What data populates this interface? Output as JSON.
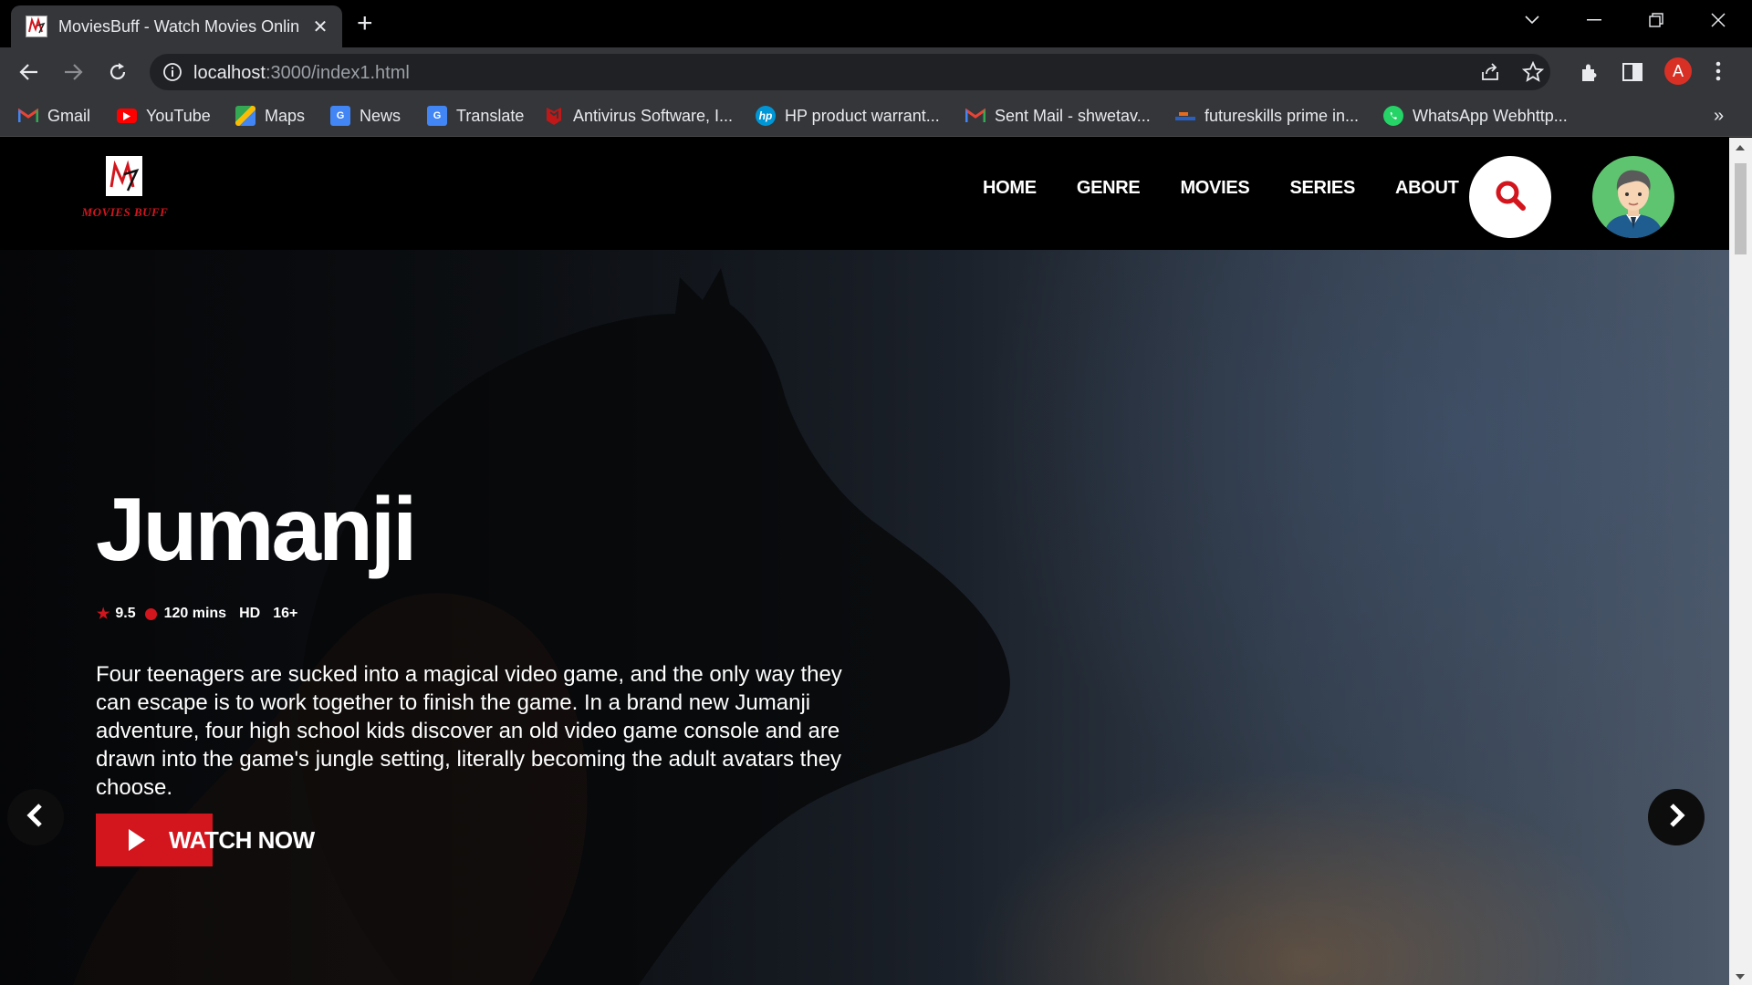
{
  "browser": {
    "tab_title": "MoviesBuff - Watch Movies Onlin",
    "url_host": "localhost",
    "url_rest": ":3000/index1.html",
    "profile_initial": "A"
  },
  "bookmarks": [
    {
      "label": "Gmail",
      "icon": "gmail-icon"
    },
    {
      "label": "YouTube",
      "icon": "youtube-icon"
    },
    {
      "label": "Maps",
      "icon": "maps-icon"
    },
    {
      "label": "News",
      "icon": "news-icon"
    },
    {
      "label": "Translate",
      "icon": "translate-icon"
    },
    {
      "label": "Antivirus Software, I...",
      "icon": "mcafee-icon"
    },
    {
      "label": "HP product warrant...",
      "icon": "hp-icon"
    },
    {
      "label": "Sent Mail - shwetav...",
      "icon": "gmail-icon"
    },
    {
      "label": "futureskills prime in...",
      "icon": "futureskills-icon"
    },
    {
      "label": "WhatsApp Webhttp...",
      "icon": "whatsapp-icon"
    }
  ],
  "site": {
    "logo_text": "MOVIES BUFF",
    "nav": [
      "HOME",
      "GENRE",
      "MOVIES",
      "SERIES",
      "ABOUT"
    ]
  },
  "hero": {
    "title": "Jumanji",
    "rating": "9.5",
    "duration": "120 mins",
    "quality": "HD",
    "age": "16+",
    "description": "Four teenagers are sucked into a magical video game, and the only way they can escape is to work together to finish the game. In a brand new Jumanji adventure, four high school kids discover an old video game console and are drawn into the game's jungle setting, literally becoming the adult avatars they choose.",
    "cta": "WATCH NOW"
  },
  "colors": {
    "accent": "#d3151d",
    "chrome_bg": "#35363a",
    "page_bg": "#000000"
  }
}
